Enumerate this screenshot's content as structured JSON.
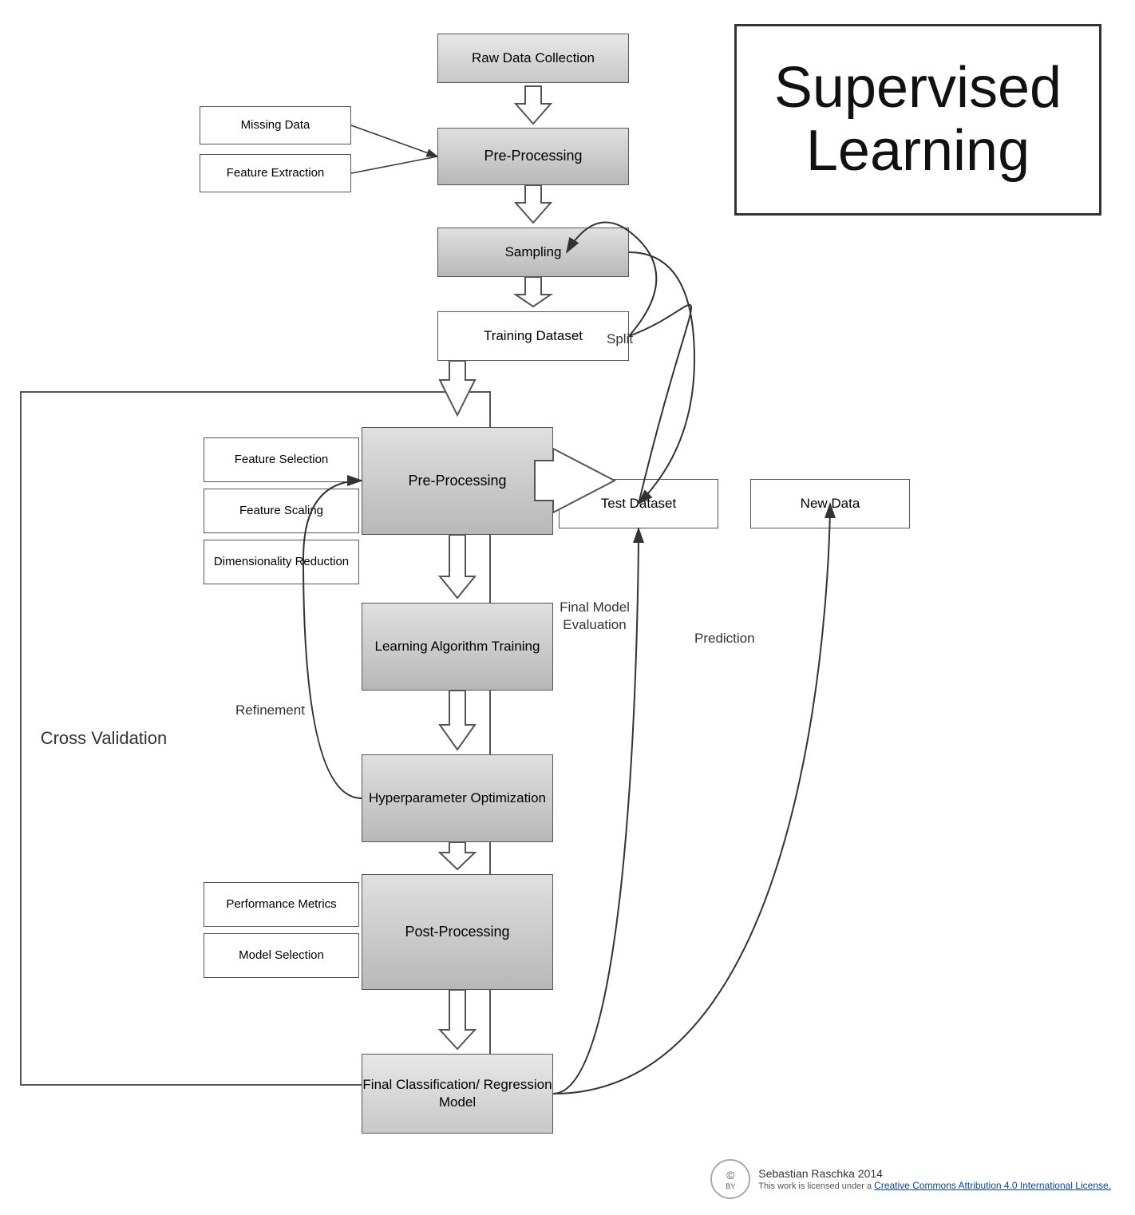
{
  "title": "Supervised Learning",
  "boxes": {
    "raw_data": "Raw Data Collection",
    "pre_processing_top": "Pre-Processing",
    "sampling": "Sampling",
    "training_dataset": "Training Dataset",
    "pre_processing_mid": "Pre-Processing",
    "learning_algorithm": "Learning Algorithm\nTraining",
    "hyperparameter": "Hyperparameter\nOptimization",
    "post_processing": "Post-Processing",
    "final_classification": "Final Classification/\nRegression Model",
    "test_dataset": "Test Dataset",
    "new_data": "New Data",
    "missing_data": "Missing Data",
    "feature_extraction": "Feature Extraction",
    "feature_selection": "Feature Selection",
    "feature_scaling": "Feature Scaling",
    "dimensionality_reduction": "Dimensionality Reduction",
    "performance_metrics": "Performance Metrics",
    "model_selection": "Model Selection"
  },
  "labels": {
    "split": "Split",
    "refinement": "Refinement",
    "prediction": "Prediction",
    "final_model_evaluation": "Final Model\nEvaluation",
    "cross_validation": "Cross Validation"
  },
  "footer": {
    "author": "Sebastian Raschka 2014",
    "license_text": "This work is licensed under a",
    "license_link": "Creative Commons Attribution 4.0 International License."
  }
}
